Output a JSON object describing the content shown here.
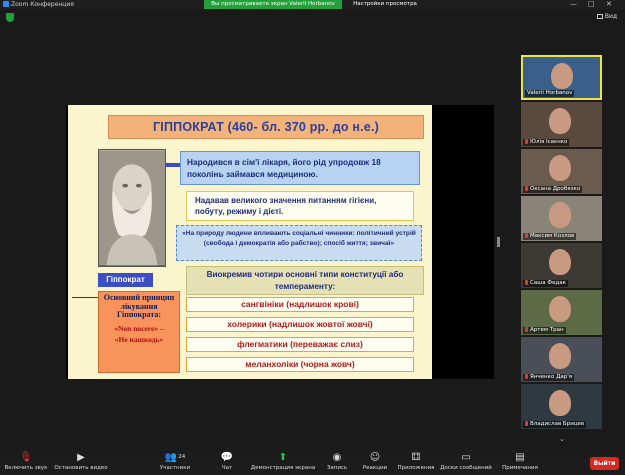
{
  "window": {
    "app_title": "Zoom Конференция",
    "viewing_banner": "Вы просматриваете экран Valerii Horbanov",
    "view_options": "Настройки просмотра",
    "controls": [
      "—",
      "□",
      "✕"
    ]
  },
  "top_right": {
    "view_label": "Вид"
  },
  "slide": {
    "title": "ГІППОКРАТ (460- бл. 370 рр. до н.е.)",
    "name_label": "Гіппократ",
    "principle_title": "Основний принцип лікування Гіппократа:",
    "principle_q1": "«Non nocere» –",
    "principle_q2": "«Не нашкодь»",
    "box1": "Народився в сім'ї лікаря, його рід упродовж 18 поколінь займався медициною.",
    "box2": "Надавав великого значення питанням гігієни, побуту, режиму і дієті.",
    "box3": "«На природу людини впливають соціальні чинники: політичний устрій (свобода і демократія або рабство); спосіб життя; звичаї»",
    "box4": "Виокремив чотири основні типи конституції або темпераменту:",
    "types": [
      "сангвініки (надлишок крові)",
      "холерики (надлишок жовтої жовчі)",
      "флегматики (переважає слиз)",
      "меланхоліки (чорна жовч)"
    ]
  },
  "participants": [
    {
      "name": "Valerii Horbanov",
      "bg": "#3a5f8a",
      "active": true
    },
    {
      "name": "Юлія Ісаєнко",
      "bg": "#5a4a3e"
    },
    {
      "name": "Оксана Дробязко",
      "bg": "#6b5b4d"
    },
    {
      "name": "Максим Козлов",
      "bg": "#8a8478"
    },
    {
      "name": "Саша Федак",
      "bg": "#3d3a35"
    },
    {
      "name": "Артем Тран",
      "bg": "#5c6b45"
    },
    {
      "name": "Янченко Дар'я",
      "bg": "#4a4f57"
    },
    {
      "name": "Владислав Брицев",
      "bg": "#2e3a40"
    }
  ],
  "toolbar": {
    "mic_label": "Включить звук",
    "video_label": "Остановить видео",
    "participants_label": "Участники",
    "participants_count": "24",
    "chat_label": "Чат",
    "share_label": "Демонстрация экрана",
    "record_label": "Запись",
    "reactions_label": "Реакции",
    "apps_label": "Приложения",
    "whiteboard_label": "Доски сообщений",
    "notes_label": "Примечания",
    "exit_label": "Выйти"
  },
  "colors": {
    "share_green": "#22a13a",
    "exit_red": "#d9281f",
    "active_yellow": "#e8e44a"
  }
}
